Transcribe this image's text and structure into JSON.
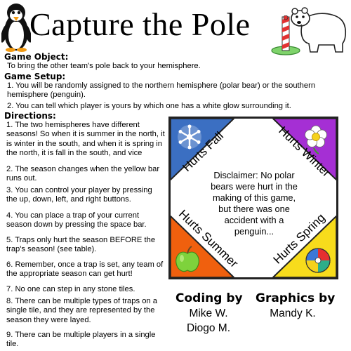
{
  "header": {
    "title": "Capture the Pole",
    "icons": [
      "penguin-icon",
      "polar-bear-icon",
      "striped-pole-icon"
    ]
  },
  "sections": {
    "object": {
      "heading": "Game Object:",
      "text": "To bring the other team's pole back to your hemisphere."
    },
    "setup": {
      "heading": "Game Setup:",
      "items": [
        "1.  You will be randomly assigned to the northern hemisphere (polar bear) or the southern hemisphere (penguin).",
        "2.  You can tell which player is yours by which one has a white glow surrounding it."
      ]
    },
    "directions": {
      "heading": "Directions:",
      "items": [
        "1. The two hemispheres have different seasons! So when it is summer in the north, it is winter in the south, and when it is spring in the north, it is fall in the south, and vice",
        "2. The season changes when the yellow bar runs out.",
        "3. You can control your player by pressing the up, down, left, and right buttons.",
        "4. You can place a trap of your current season down by pressing the space bar.",
        "5. Traps only hurt the season BEFORE the trap's season! (see table).",
        "6. Remember, once a trap is set, any team of the appropriate season can get hurt!",
        "7. No one can step in any stone tiles.",
        "8. There can be multiple types of traps on a single tile, and they are represented by the season they were layed.",
        "9. There can be multiple players in a single tile."
      ]
    }
  },
  "season_table": {
    "labels": {
      "fall": "Hurts Fall",
      "winter": "Hurts Winter",
      "summer": "Hurts Summer",
      "spring": "Hurts Spring"
    },
    "disclaimer": "Disclaimer: No polar bears were hurt in the making of this game, but there was one accident with a penguin...",
    "colors": {
      "fall": "#3b6fc2",
      "winter": "#a52fd4",
      "summer": "#f0600e",
      "spring": "#f7dc1c"
    },
    "icons": {
      "fall": "snowflake-icon",
      "winter": "flower-icon",
      "summer": "apple-icon",
      "spring": "beach-ball-icon"
    }
  },
  "credits": {
    "coding": {
      "heading": "Coding by",
      "names": [
        "Mike W.",
        "Diogo M."
      ]
    },
    "graphics": {
      "heading": "Graphics by",
      "names": [
        "Mandy K."
      ]
    }
  }
}
